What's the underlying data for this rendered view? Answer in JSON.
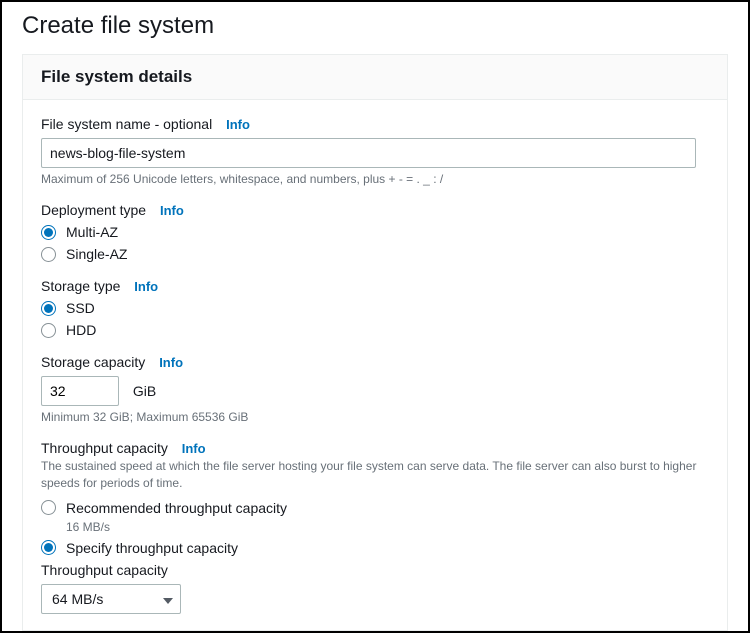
{
  "page_title": "Create file system",
  "panel": {
    "title": "File system details",
    "fs_name": {
      "label": "File system name - optional",
      "info": "Info",
      "value": "news-blog-file-system",
      "helper": "Maximum of 256 Unicode letters, whitespace, and numbers, plus + - = . _ : /"
    },
    "deployment_type": {
      "label": "Deployment type",
      "info": "Info",
      "options": [
        {
          "label": "Multi-AZ",
          "checked": true
        },
        {
          "label": "Single-AZ",
          "checked": false
        }
      ]
    },
    "storage_type": {
      "label": "Storage type",
      "info": "Info",
      "options": [
        {
          "label": "SSD",
          "checked": true
        },
        {
          "label": "HDD",
          "checked": false
        }
      ]
    },
    "storage_capacity": {
      "label": "Storage capacity",
      "info": "Info",
      "value": "32",
      "unit": "GiB",
      "helper": "Minimum 32 GiB; Maximum 65536 GiB"
    },
    "throughput": {
      "label": "Throughput capacity",
      "info": "Info",
      "helper": "The sustained speed at which the file server hosting your file system can serve data. The file server can also burst to higher speeds for periods of time.",
      "options": [
        {
          "label": "Recommended throughput capacity",
          "sub": "16 MB/s",
          "checked": false
        },
        {
          "label": "Specify throughput capacity",
          "checked": true
        }
      ],
      "select_label": "Throughput capacity",
      "select_value": "64 MB/s"
    }
  }
}
